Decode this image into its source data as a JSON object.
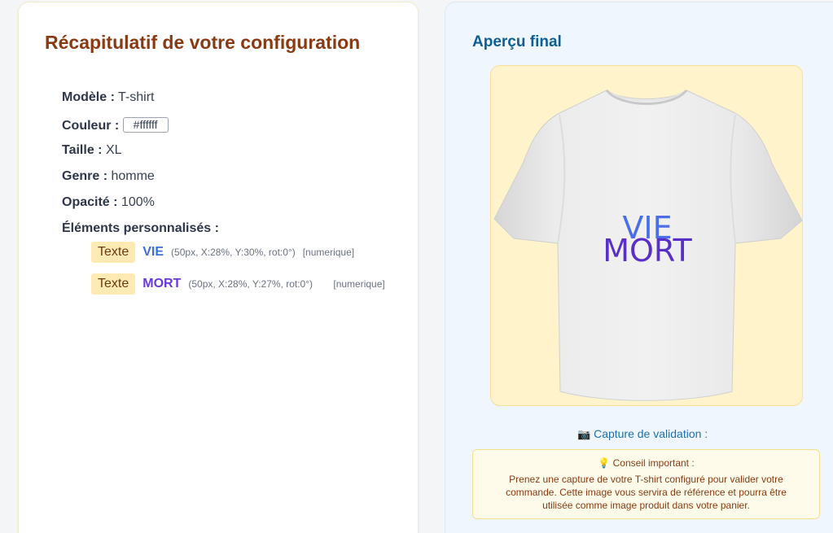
{
  "summary": {
    "title": "Récapitulatif de votre configuration",
    "model_label": "Modèle :",
    "model_value": "T-shirt",
    "color_label": "Couleur :",
    "color_value": "#ffffff",
    "size_label": "Taille :",
    "size_value": "XL",
    "gender_label": "Genre :",
    "gender_value": "homme",
    "opacity_label": "Opacité :",
    "opacity_value": "100%",
    "elements_label": "Éléments personnalisés :",
    "elements": [
      {
        "type": "Texte",
        "text": "VIE",
        "text_color": "#3b6fe0",
        "meta": "(50px, X:28%, Y:30%, rot:0°)",
        "tag": "[numerique]"
      },
      {
        "type": "Texte",
        "text": "MORT",
        "text_color": "#6a3ad8",
        "meta": "(50px, X:28%, Y:27%, rot:0°)",
        "tag": "[numerique]"
      }
    ]
  },
  "preview": {
    "title": "Aperçu final",
    "shirt_color": "#ffffff",
    "overlay": [
      {
        "text": "VIE",
        "color": "#4a6fe8"
      },
      {
        "text": "MORT",
        "color": "#5a2fc8"
      }
    ],
    "capture_icon": "camera-icon",
    "capture_label": "Capture de validation :",
    "tip_icon": "lightbulb-icon",
    "tip_title": "Conseil important :",
    "tip_text": "Prenez une capture de votre T-shirt configuré pour valider votre commande. Cette image vous servira de référence et pourra être utilisée comme image produit dans votre panier."
  },
  "colors": {
    "title_brown": "#8a3a12",
    "accent_blue": "#0f5f96",
    "badge_bg": "#fdebb3",
    "preview_bg": "#fff3cc"
  }
}
